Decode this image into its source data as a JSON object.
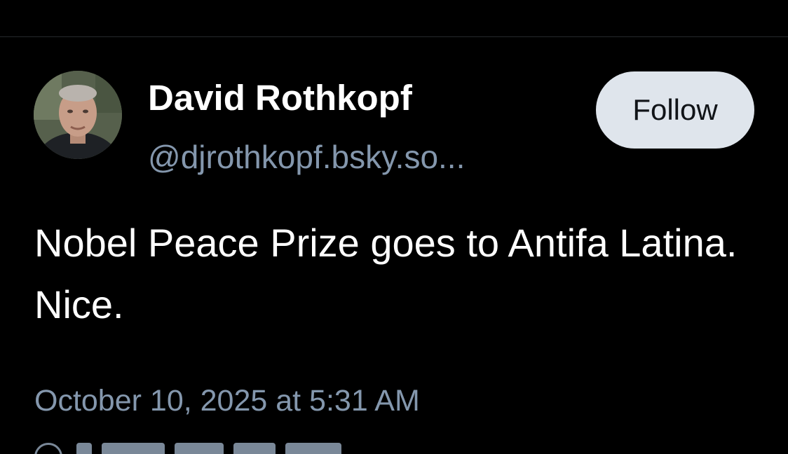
{
  "post": {
    "author": {
      "display_name": "David Rothkopf",
      "handle": "@djrothkopf.bsky.so..."
    },
    "follow_label": "Follow",
    "text": "Nobel Peace Prize goes to Antifa Latina. Nice.",
    "timestamp": "October 10, 2025 at 5:31 AM"
  },
  "icons": {
    "avatar": "profile-photo",
    "reply_settings": "globe-icon"
  },
  "colors": {
    "background": "#000000",
    "text_primary": "#ffffff",
    "text_secondary": "#8497ad",
    "follow_button_bg": "#dfe5ec",
    "follow_button_text": "#111418"
  }
}
